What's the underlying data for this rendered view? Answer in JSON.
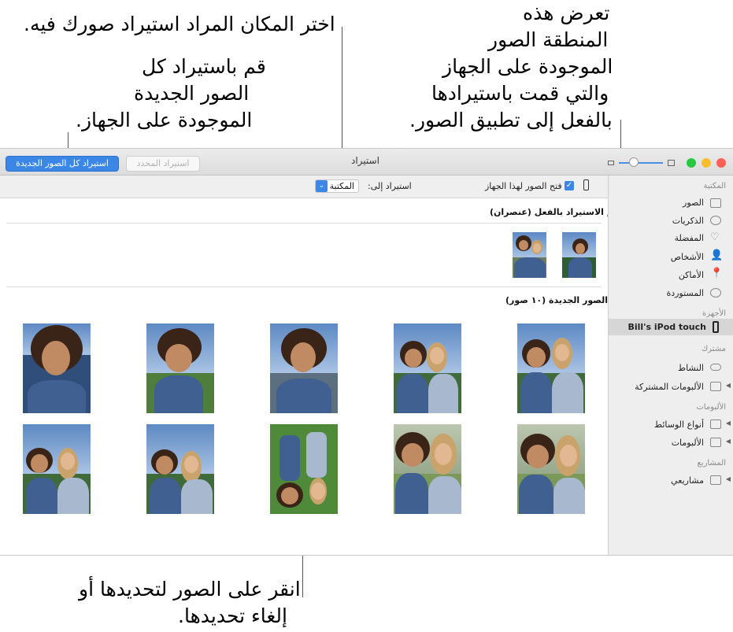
{
  "callouts": {
    "choose_location": "اختر المكان المراد استيراد صورك فيه.",
    "import_all": [
      "قم باستيراد كل",
      "الصور الجديدة",
      "الموجودة على الجهاز."
    ],
    "area_shows": [
      "تعرض هذه",
      "المنطقة الصور",
      "الموجودة على الجهاز",
      "والتي قمت باستيرادها",
      "بالفعل إلى تطبيق الصور."
    ],
    "click_photos": [
      "انقر على الصور لتحديدها أو",
      "إلغاء تحديدها."
    ]
  },
  "toolbar": {
    "import_all_label": "استيراد كل الصور الجديدة",
    "import_selected_label": "استيراد المحدد",
    "window_title": "استيراد"
  },
  "subbar": {
    "open_photos_label": "فتح الصور لهذا الجهاز",
    "import_to_label": "استيراد إلى:",
    "import_to_value": "المكتبة"
  },
  "main": {
    "already_imported_title": "تم الاستيراد بالفعل (عنصران)",
    "new_photos_title": "الصور الجديدة (١٠ صور)"
  },
  "sidebar": {
    "library_header": "المكتبة",
    "library_items": [
      "الصور",
      "الذكريات",
      "المفضلة",
      "الأشخاص",
      "الأماكن",
      "المستوردة"
    ],
    "devices_header": "الأجهزة",
    "device_name": "Bill's iPod touch",
    "shared_header": "مشترك",
    "shared_items": [
      "النشاط",
      "الألبومات المشتركة"
    ],
    "albums_header": "الألبومات",
    "albums_items": [
      "أنواع الوسائط",
      "الألبومات"
    ],
    "projects_header": "المشاريع",
    "projects_items": [
      "مشاريعي"
    ]
  },
  "colors": {
    "accent": "#3b87e8",
    "close": "#fe5f57",
    "minimize": "#febc2e",
    "zoom": "#28c840"
  }
}
